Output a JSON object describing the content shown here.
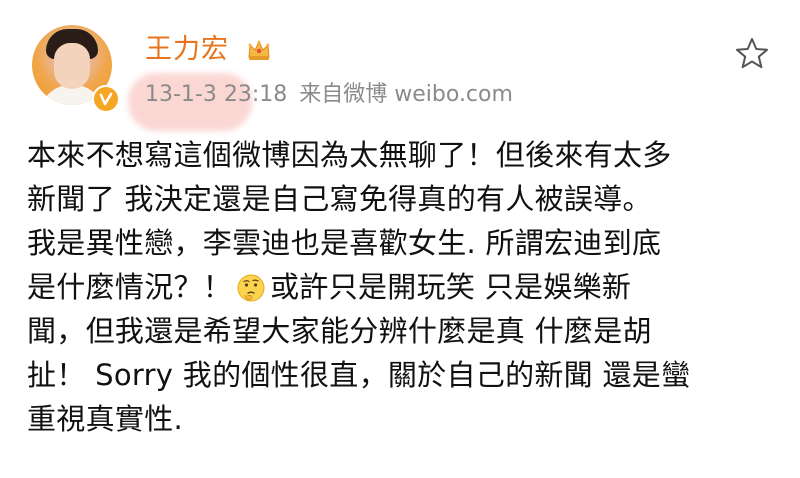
{
  "user": {
    "name": "王力宏",
    "verified": true,
    "avatar_alt": ""
  },
  "meta": {
    "timestamp": "13-1-3 23:18",
    "source": "来自微博 weibo.com"
  },
  "post": {
    "lines": [
      "本來不想寫這個微博因為太無聊了！但後來有太多",
      "新聞了 我決定還是自己寫免得真的有人被誤導。",
      "我是異性戀，李雲迪也是喜歡女生. 所謂宏迪到底",
      "是什麼情況？！",
      "或許只是開玩笑 只是娛樂新",
      "聞，但我還是希望大家能分辨什麼是真 什麼是胡",
      "扯！ Sorry 我的個性很直，關於自己的新聞 還是蠻",
      "重視真實性."
    ]
  },
  "colors": {
    "name": "#e8741e",
    "meta": "#8a8a8a",
    "badge": "#f5a623",
    "highlight": "#fbd3d0"
  },
  "icons": {
    "crown": "crown-icon",
    "verified": "verified-badge-icon",
    "favorite": "star-outline-icon",
    "emoji": "thinking-face-emoji"
  }
}
